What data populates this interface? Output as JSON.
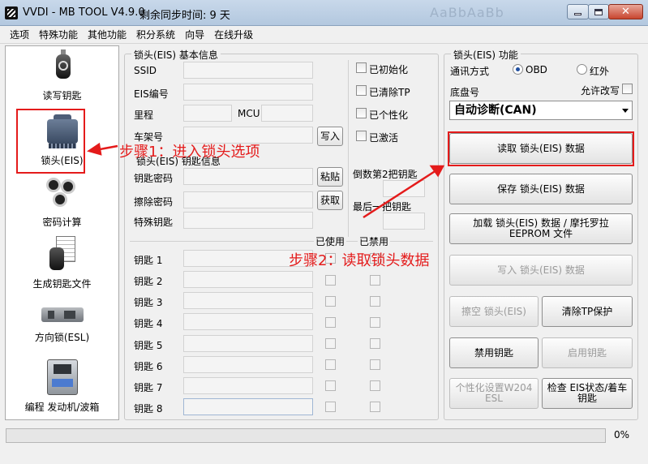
{
  "window": {
    "title": "VVDI - MB TOOL V4.9.0",
    "sync_text": "剩余同步时间: 9 天",
    "ghost_text": "AaBbAaBb"
  },
  "menu": [
    "选项",
    "特殊功能",
    "其他功能",
    "积分系统",
    "向导",
    "在线升级"
  ],
  "sidebar": {
    "items": [
      {
        "label": "读写钥匙",
        "icon": "car-key-icon"
      },
      {
        "label": "锁头(EIS)",
        "icon": "eis-module-icon"
      },
      {
        "label": "密码计算",
        "icon": "password-calc-icon"
      },
      {
        "label": "生成钥匙文件",
        "icon": "key-file-icon"
      },
      {
        "label": "方向锁(ESL)",
        "icon": "esl-lock-icon"
      },
      {
        "label": "编程 发动机/波箱",
        "icon": "ecu-icon"
      }
    ]
  },
  "eis_basic": {
    "title": "锁头(EIS) 基本信息",
    "ssid": "SSID",
    "eis_no": "EIS编号",
    "mileage": "里程",
    "mcu": "MCU",
    "vin": "车架号",
    "write_btn": "写入",
    "checks": [
      "已初始化",
      "已清除TP",
      "已个性化",
      "已激活"
    ],
    "ssid_value": "",
    "eis_no_value": "",
    "mileage_value": "",
    "mcu_value": "",
    "vin_value": ""
  },
  "key_info": {
    "title": "锁头(EIS) 钥匙信息",
    "key_password": "钥匙密码",
    "erase_password": "擦除密码",
    "special_key": "特殊钥匙",
    "paste_btn": "粘贴",
    "get_btn": "获取",
    "second_last_key": "倒数第2把钥匙",
    "last_key": "最后一把钥匙",
    "col_used": "已使用",
    "col_disabled": "已禁用",
    "keys": [
      "钥匙 1",
      "钥匙 2",
      "钥匙 3",
      "钥匙 4",
      "钥匙 5",
      "钥匙 6",
      "钥匙 7",
      "钥匙 8"
    ]
  },
  "eis_func": {
    "title": "锁头(EIS) 功能",
    "comm_mode": "通讯方式",
    "obd": "OBD",
    "ir": "红外",
    "selected_mode": "OBD",
    "chassis": "底盘号",
    "allow_modify": "允许改写",
    "chassis_value": "自动诊断(CAN)",
    "buttons": {
      "read": "读取 锁头(EIS) 数据",
      "save": "保存 锁头(EIS) 数据",
      "load": "加载 锁头(EIS) 数据 / 摩托罗拉EEPROM 文件",
      "write": "写入 锁头(EIS) 数据",
      "erase": "擦空 锁头(EIS)",
      "clear_tp": "清除TP保护",
      "disable_key": "禁用钥匙",
      "enable_key": "启用钥匙",
      "personalize": "个性化设置W204 ESL",
      "check": "检查 EIS状态/着车钥匙"
    }
  },
  "annotations": {
    "step1": "步骤1：进入锁头选项",
    "step2": "步骤2：读取锁头数据"
  },
  "progress": {
    "value": 0,
    "label": "0%"
  },
  "colors": {
    "annotation": "#e41b1b",
    "titlebar": "#b3c8df",
    "progress": "#5fb85f"
  }
}
